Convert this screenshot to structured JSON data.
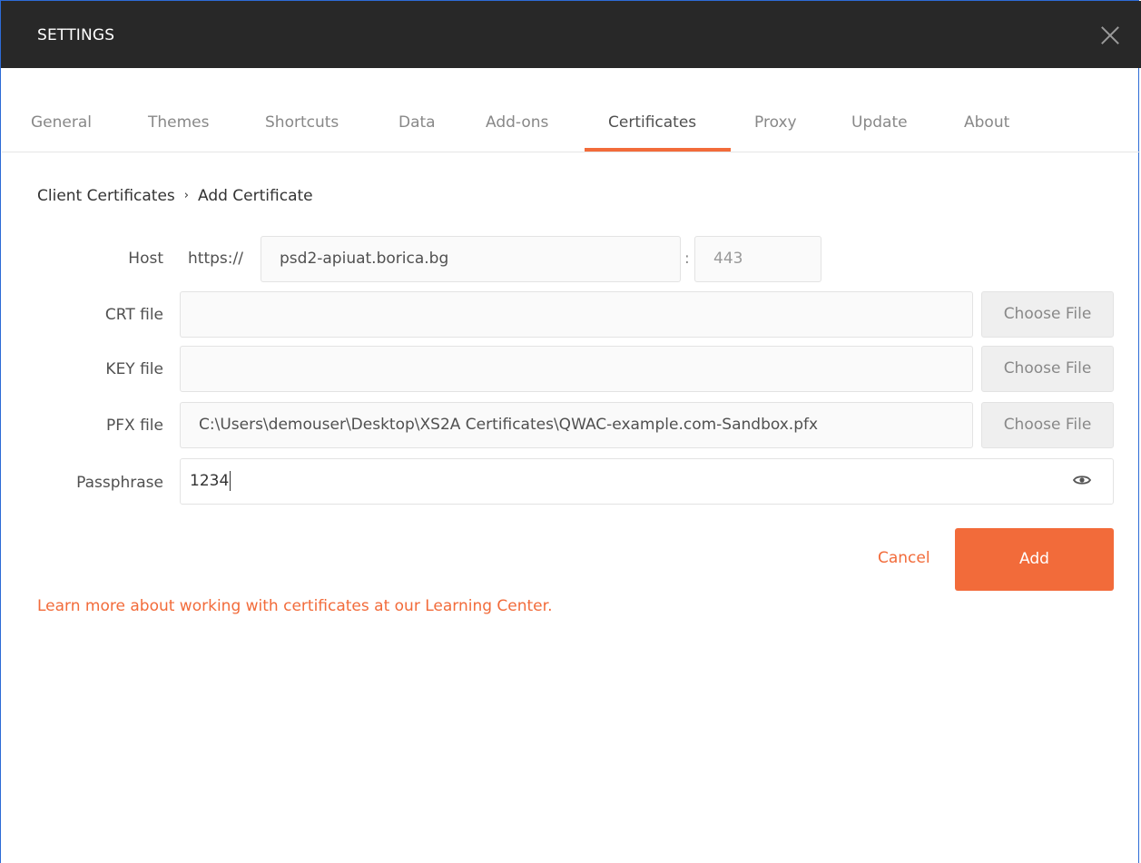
{
  "window": {
    "title": "SETTINGS"
  },
  "tabs": [
    {
      "label": "General"
    },
    {
      "label": "Themes"
    },
    {
      "label": "Shortcuts"
    },
    {
      "label": "Data"
    },
    {
      "label": "Add-ons"
    },
    {
      "label": "Certificates",
      "active": true
    },
    {
      "label": "Proxy"
    },
    {
      "label": "Update"
    },
    {
      "label": "About"
    }
  ],
  "breadcrumb": {
    "parent": "Client Certificates",
    "separator": "›",
    "current": "Add Certificate"
  },
  "form": {
    "host": {
      "label": "Host",
      "prefix": "https://",
      "value": "psd2-apiuat.borica.bg",
      "port_separator": ":",
      "port_value": "443"
    },
    "crt": {
      "label": "CRT file",
      "value": "",
      "button": "Choose File"
    },
    "key": {
      "label": "KEY file",
      "value": "",
      "button": "Choose File"
    },
    "pfx": {
      "label": "PFX file",
      "value": "C:\\Users\\demouser\\Desktop\\XS2A Certificates\\QWAC-example.com-Sandbox.pfx",
      "button": "Choose File"
    },
    "passphrase": {
      "label": "Passphrase",
      "value": "1234",
      "toggle_icon": "eye-icon"
    }
  },
  "actions": {
    "cancel": "Cancel",
    "add": "Add"
  },
  "learn_more": "Learn more about working with certificates at our Learning Center.",
  "colors": {
    "accent": "#f26b3a",
    "titlebar": "#282828",
    "frame": "#2d6bd6"
  }
}
